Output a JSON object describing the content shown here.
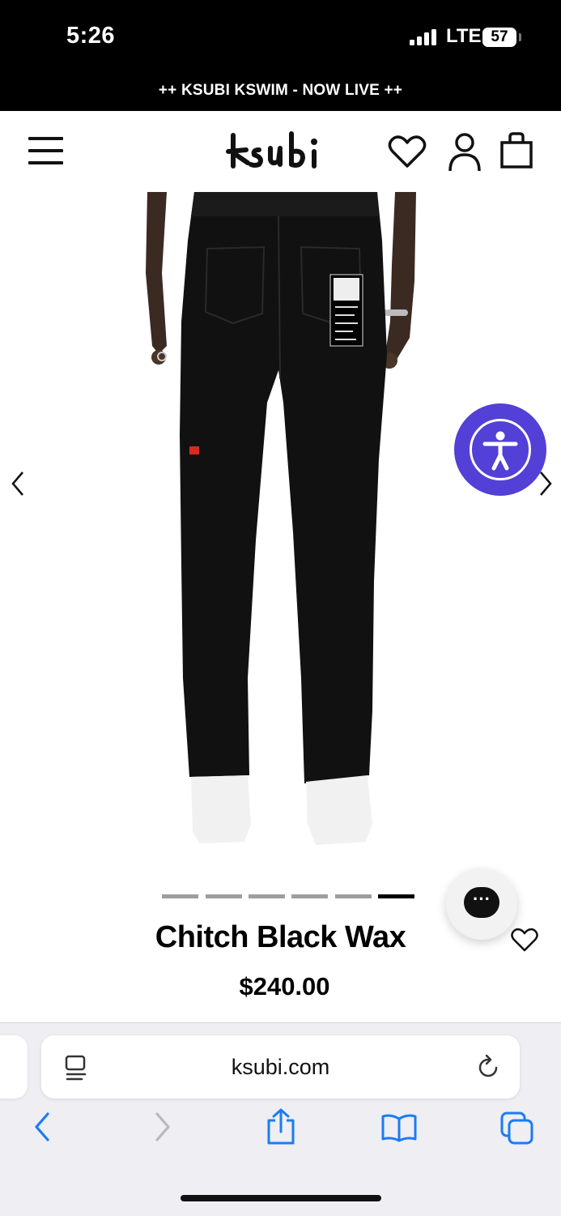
{
  "status_bar": {
    "time": "5:26",
    "network": "LTE",
    "battery": "57",
    "battery_fraction": 0.57
  },
  "announcement": {
    "text": "++ KSUBI KSWIM - NOW LIVE ++"
  },
  "header": {
    "logo_text": "ksubi"
  },
  "gallery": {
    "image_count": 6,
    "active_index": 5
  },
  "product": {
    "title": "Chitch Black Wax",
    "price": "$240.00"
  },
  "browser": {
    "url": "ksubi.com"
  },
  "colors": {
    "accessibility": "#5340d6",
    "ios_blue": "#1a7cf5",
    "ios_disabled": "#b8b8bd"
  },
  "icons": [
    "menu-icon",
    "heart-icon",
    "account-icon",
    "bag-icon",
    "chevron-left-icon",
    "chevron-right-icon",
    "accessibility-icon",
    "chat-icon",
    "reader-icon",
    "reload-icon",
    "back-icon",
    "forward-icon",
    "share-icon",
    "bookmarks-icon",
    "tabs-icon"
  ]
}
